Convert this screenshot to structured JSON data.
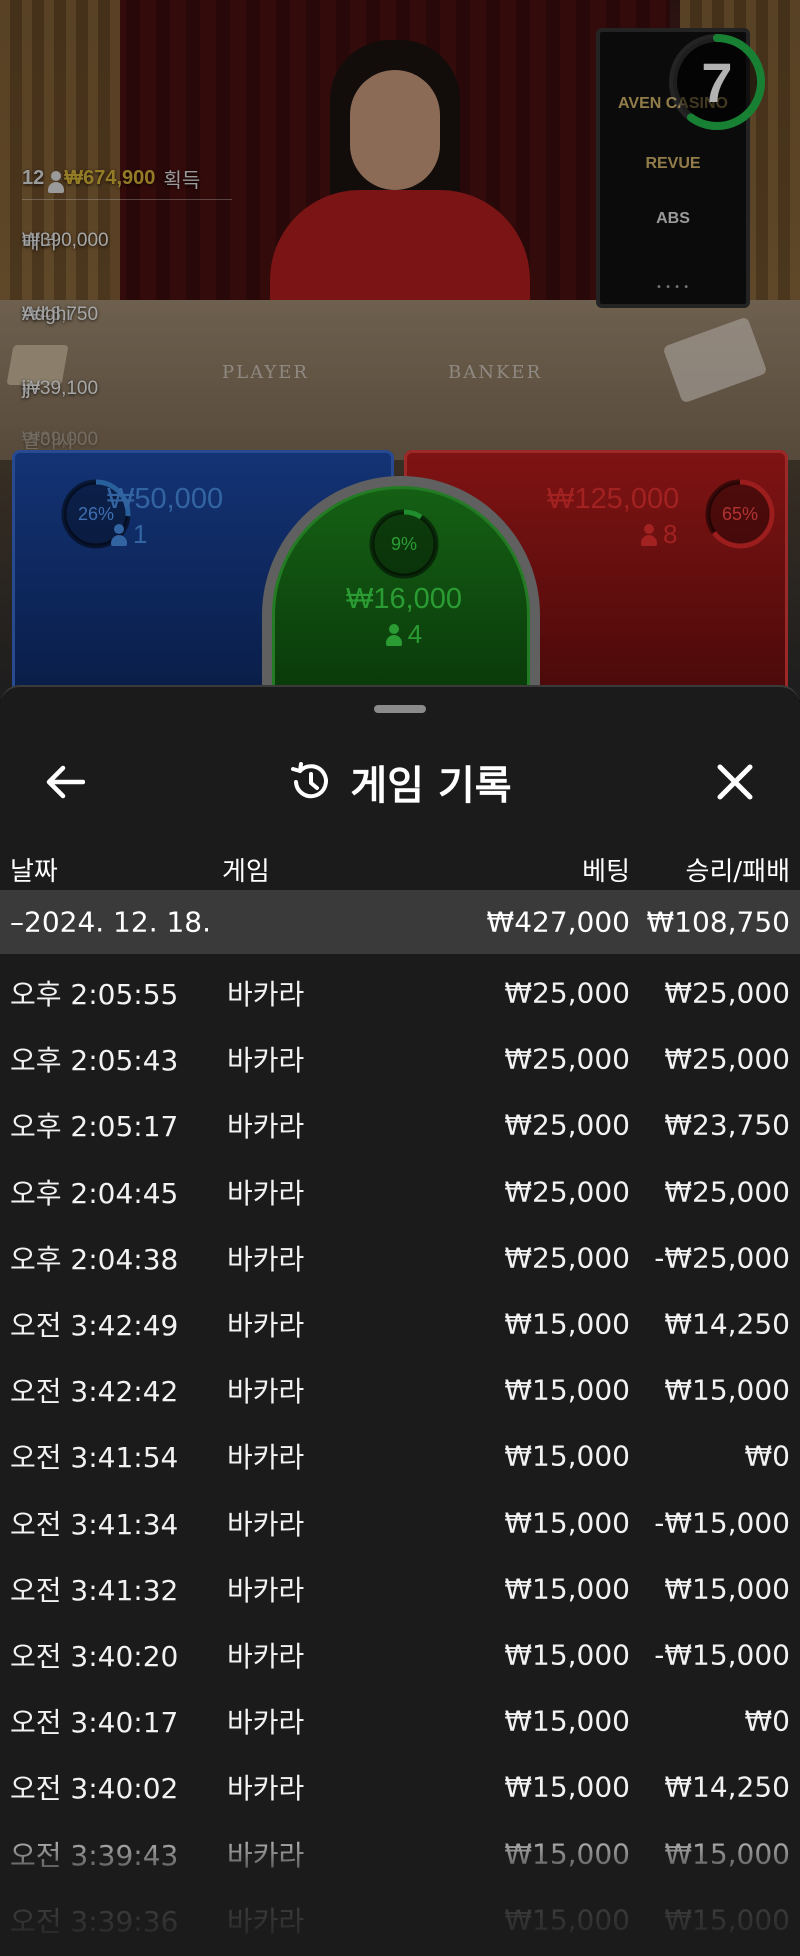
{
  "video": {
    "felt_labels": {
      "player": "PLAYER",
      "banker": "BANKER"
    },
    "side_screen_logos": [
      "AVEN CASINO",
      "REVUE",
      "ABS"
    ],
    "timer": {
      "value": "7",
      "progress": 0.6
    },
    "winners": {
      "count": "12",
      "total": "₩674,900",
      "label": "획득",
      "list": [
        {
          "amount": "₩390,000",
          "name": "매너"
        },
        {
          "amount": "₩48,750",
          "name": "Adghi"
        },
        {
          "amount": "₩39,100",
          "name": "jj"
        },
        {
          "amount": "₩39,000",
          "name": "열이사"
        }
      ]
    }
  },
  "bet_spots": {
    "player": {
      "percent": "26%",
      "percent_value": 0.26,
      "amount": "₩50,000",
      "players": "1",
      "color": "#3a8ae0"
    },
    "tie": {
      "percent": "9%",
      "percent_value": 0.09,
      "amount": "₩16,000",
      "players": "4",
      "color": "#2ecc40"
    },
    "banker": {
      "percent": "65%",
      "percent_value": 0.65,
      "amount": "₩125,000",
      "players": "8",
      "color": "#e02a2a"
    }
  },
  "sheet": {
    "title": "게임 기록",
    "icons": {
      "back": "arrow-left-icon",
      "history": "history-icon",
      "close": "close-icon"
    },
    "columns": {
      "date": "날짜",
      "game": "게임",
      "bet": "베팅",
      "result": "승리/패배"
    },
    "date_group": {
      "date": "–2024. 12. 18.",
      "bet_total": "₩427,000",
      "result_total": "₩108,750"
    },
    "rows": [
      {
        "time": "오후 2:05:55",
        "game": "바카라",
        "bet": "₩25,000",
        "result": "₩25,000"
      },
      {
        "time": "오후 2:05:43",
        "game": "바카라",
        "bet": "₩25,000",
        "result": "₩25,000"
      },
      {
        "time": "오후 2:05:17",
        "game": "바카라",
        "bet": "₩25,000",
        "result": "₩23,750"
      },
      {
        "time": "오후 2:04:45",
        "game": "바카라",
        "bet": "₩25,000",
        "result": "₩25,000"
      },
      {
        "time": "오후 2:04:38",
        "game": "바카라",
        "bet": "₩25,000",
        "result": "-₩25,000"
      },
      {
        "time": "오전 3:42:49",
        "game": "바카라",
        "bet": "₩15,000",
        "result": "₩14,250"
      },
      {
        "time": "오전 3:42:42",
        "game": "바카라",
        "bet": "₩15,000",
        "result": "₩15,000"
      },
      {
        "time": "오전 3:41:54",
        "game": "바카라",
        "bet": "₩15,000",
        "result": "₩0"
      },
      {
        "time": "오전 3:41:34",
        "game": "바카라",
        "bet": "₩15,000",
        "result": "-₩15,000"
      },
      {
        "time": "오전 3:41:32",
        "game": "바카라",
        "bet": "₩15,000",
        "result": "₩15,000"
      },
      {
        "time": "오전 3:40:20",
        "game": "바카라",
        "bet": "₩15,000",
        "result": "-₩15,000"
      },
      {
        "time": "오전 3:40:17",
        "game": "바카라",
        "bet": "₩15,000",
        "result": "₩0"
      },
      {
        "time": "오전 3:40:02",
        "game": "바카라",
        "bet": "₩15,000",
        "result": "₩14,250"
      },
      {
        "time": "오전 3:39:43",
        "game": "바카라",
        "bet": "₩15,000",
        "result": "₩15,000"
      },
      {
        "time": "오전 3:39:36",
        "game": "바카라",
        "bet": "₩15,000",
        "result": "₩15,000"
      }
    ]
  }
}
